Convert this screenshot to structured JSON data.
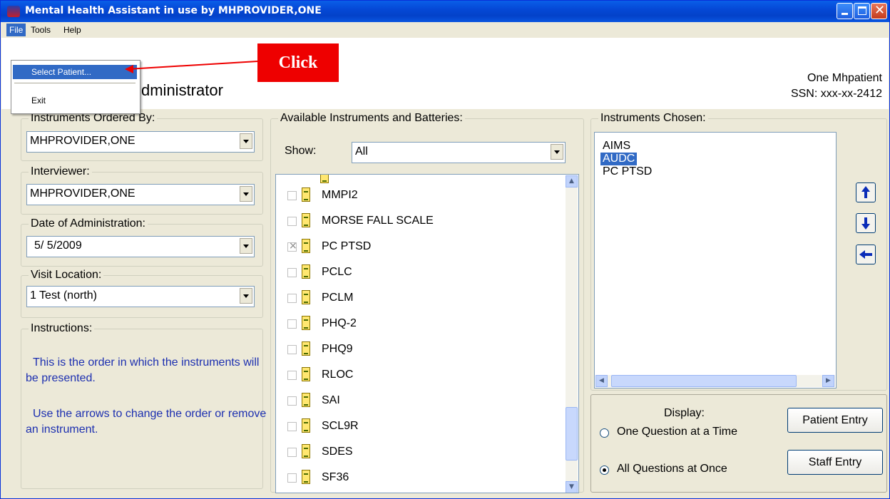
{
  "window": {
    "title": "Mental Health Assistant in use by MHPROVIDER,ONE",
    "accent": "#0548D6",
    "controls": [
      "minimize-icon",
      "maximize-icon",
      "close-icon"
    ]
  },
  "menubar": {
    "file": "File",
    "tools": "Tools",
    "help": "Help"
  },
  "file_menu": {
    "items": [
      {
        "label": "Select Patient...",
        "selected": true
      },
      {
        "label": "Exit",
        "selected": false
      }
    ]
  },
  "callout": {
    "text": "Click",
    "color": "#EE0000"
  },
  "header": {
    "title_partial": "dministrator",
    "patient_name": "One Mhpatient",
    "patient_ssn": "SSN: xxx-xx-2412"
  },
  "ordered_by": {
    "legend": "Instruments Ordered By:",
    "value": "MHPROVIDER,ONE"
  },
  "interviewer": {
    "legend": "Interviewer:",
    "value": "MHPROVIDER,ONE"
  },
  "date": {
    "legend": "Date of Administration:",
    "value": "5/ 5/2009"
  },
  "visit_location": {
    "legend": "Visit Location:",
    "value": "1 Test (north)"
  },
  "instructions": {
    "legend": "Instructions:",
    "para1": "This is the order in which the instruments will be presented.",
    "para2": "Use the arrows to change the order or remove an instrument."
  },
  "available": {
    "legend": "Available Instruments and Batteries:",
    "show_label": "Show:",
    "show_value": "All",
    "items": [
      {
        "name": "MMPI2",
        "checked": false
      },
      {
        "name": "MORSE FALL SCALE",
        "checked": false
      },
      {
        "name": "PC PTSD",
        "checked": true
      },
      {
        "name": "PCLC",
        "checked": false
      },
      {
        "name": "PCLM",
        "checked": false
      },
      {
        "name": "PHQ-2",
        "checked": false
      },
      {
        "name": "PHQ9",
        "checked": false
      },
      {
        "name": "RLOC",
        "checked": false
      },
      {
        "name": "SAI",
        "checked": false
      },
      {
        "name": "SCL9R",
        "checked": false
      },
      {
        "name": "SDES",
        "checked": false
      },
      {
        "name": "SF36",
        "checked": false
      }
    ]
  },
  "chosen": {
    "legend": "Instruments Chosen:",
    "items": [
      {
        "name": "AIMS",
        "selected": false
      },
      {
        "name": "AUDC",
        "selected": true
      },
      {
        "name": "PC PTSD",
        "selected": false
      }
    ]
  },
  "display": {
    "label": "Display:",
    "option1": "One Question at a Time",
    "option2": "All Questions at Once",
    "selected": "option2"
  },
  "buttons": {
    "patient_entry": "Patient Entry",
    "staff_entry": "Staff Entry"
  }
}
